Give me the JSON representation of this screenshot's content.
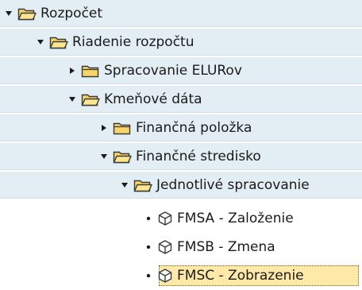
{
  "tree": {
    "nodes": [
      {
        "label": "Rozpočet",
        "type": "folder",
        "state": "expanded"
      },
      {
        "label": "Riadenie rozpočtu",
        "type": "folder",
        "state": "expanded"
      },
      {
        "label": "Spracovanie ELURov",
        "type": "folder",
        "state": "collapsed"
      },
      {
        "label": "Kmeňové dáta",
        "type": "folder",
        "state": "expanded"
      },
      {
        "label": "Finančná položka",
        "type": "folder",
        "state": "collapsed"
      },
      {
        "label": "Finančné stredisko",
        "type": "folder",
        "state": "expanded"
      },
      {
        "label": "Jednotlivé spracovanie",
        "type": "folder",
        "state": "expanded"
      },
      {
        "label": "FMSA - Založenie",
        "type": "transaction",
        "state": "leaf"
      },
      {
        "label": "FMSB - Zmena",
        "type": "transaction",
        "state": "leaf"
      },
      {
        "label": "FMSC - Zobrazenie",
        "type": "transaction",
        "state": "leaf",
        "selected": true
      }
    ]
  },
  "icons": {
    "expanded": "triangle-down-icon",
    "collapsed": "triangle-right-icon",
    "folder": "folder-icon",
    "transaction": "cube-icon",
    "leaf": "bullet-dot"
  },
  "colors": {
    "row_shade": "#e3edf4",
    "row_border": "#cfdde8",
    "folder_fill": "#f7d56a",
    "folder_stroke": "#3a3a3a",
    "selection": "#ffe9a8"
  }
}
